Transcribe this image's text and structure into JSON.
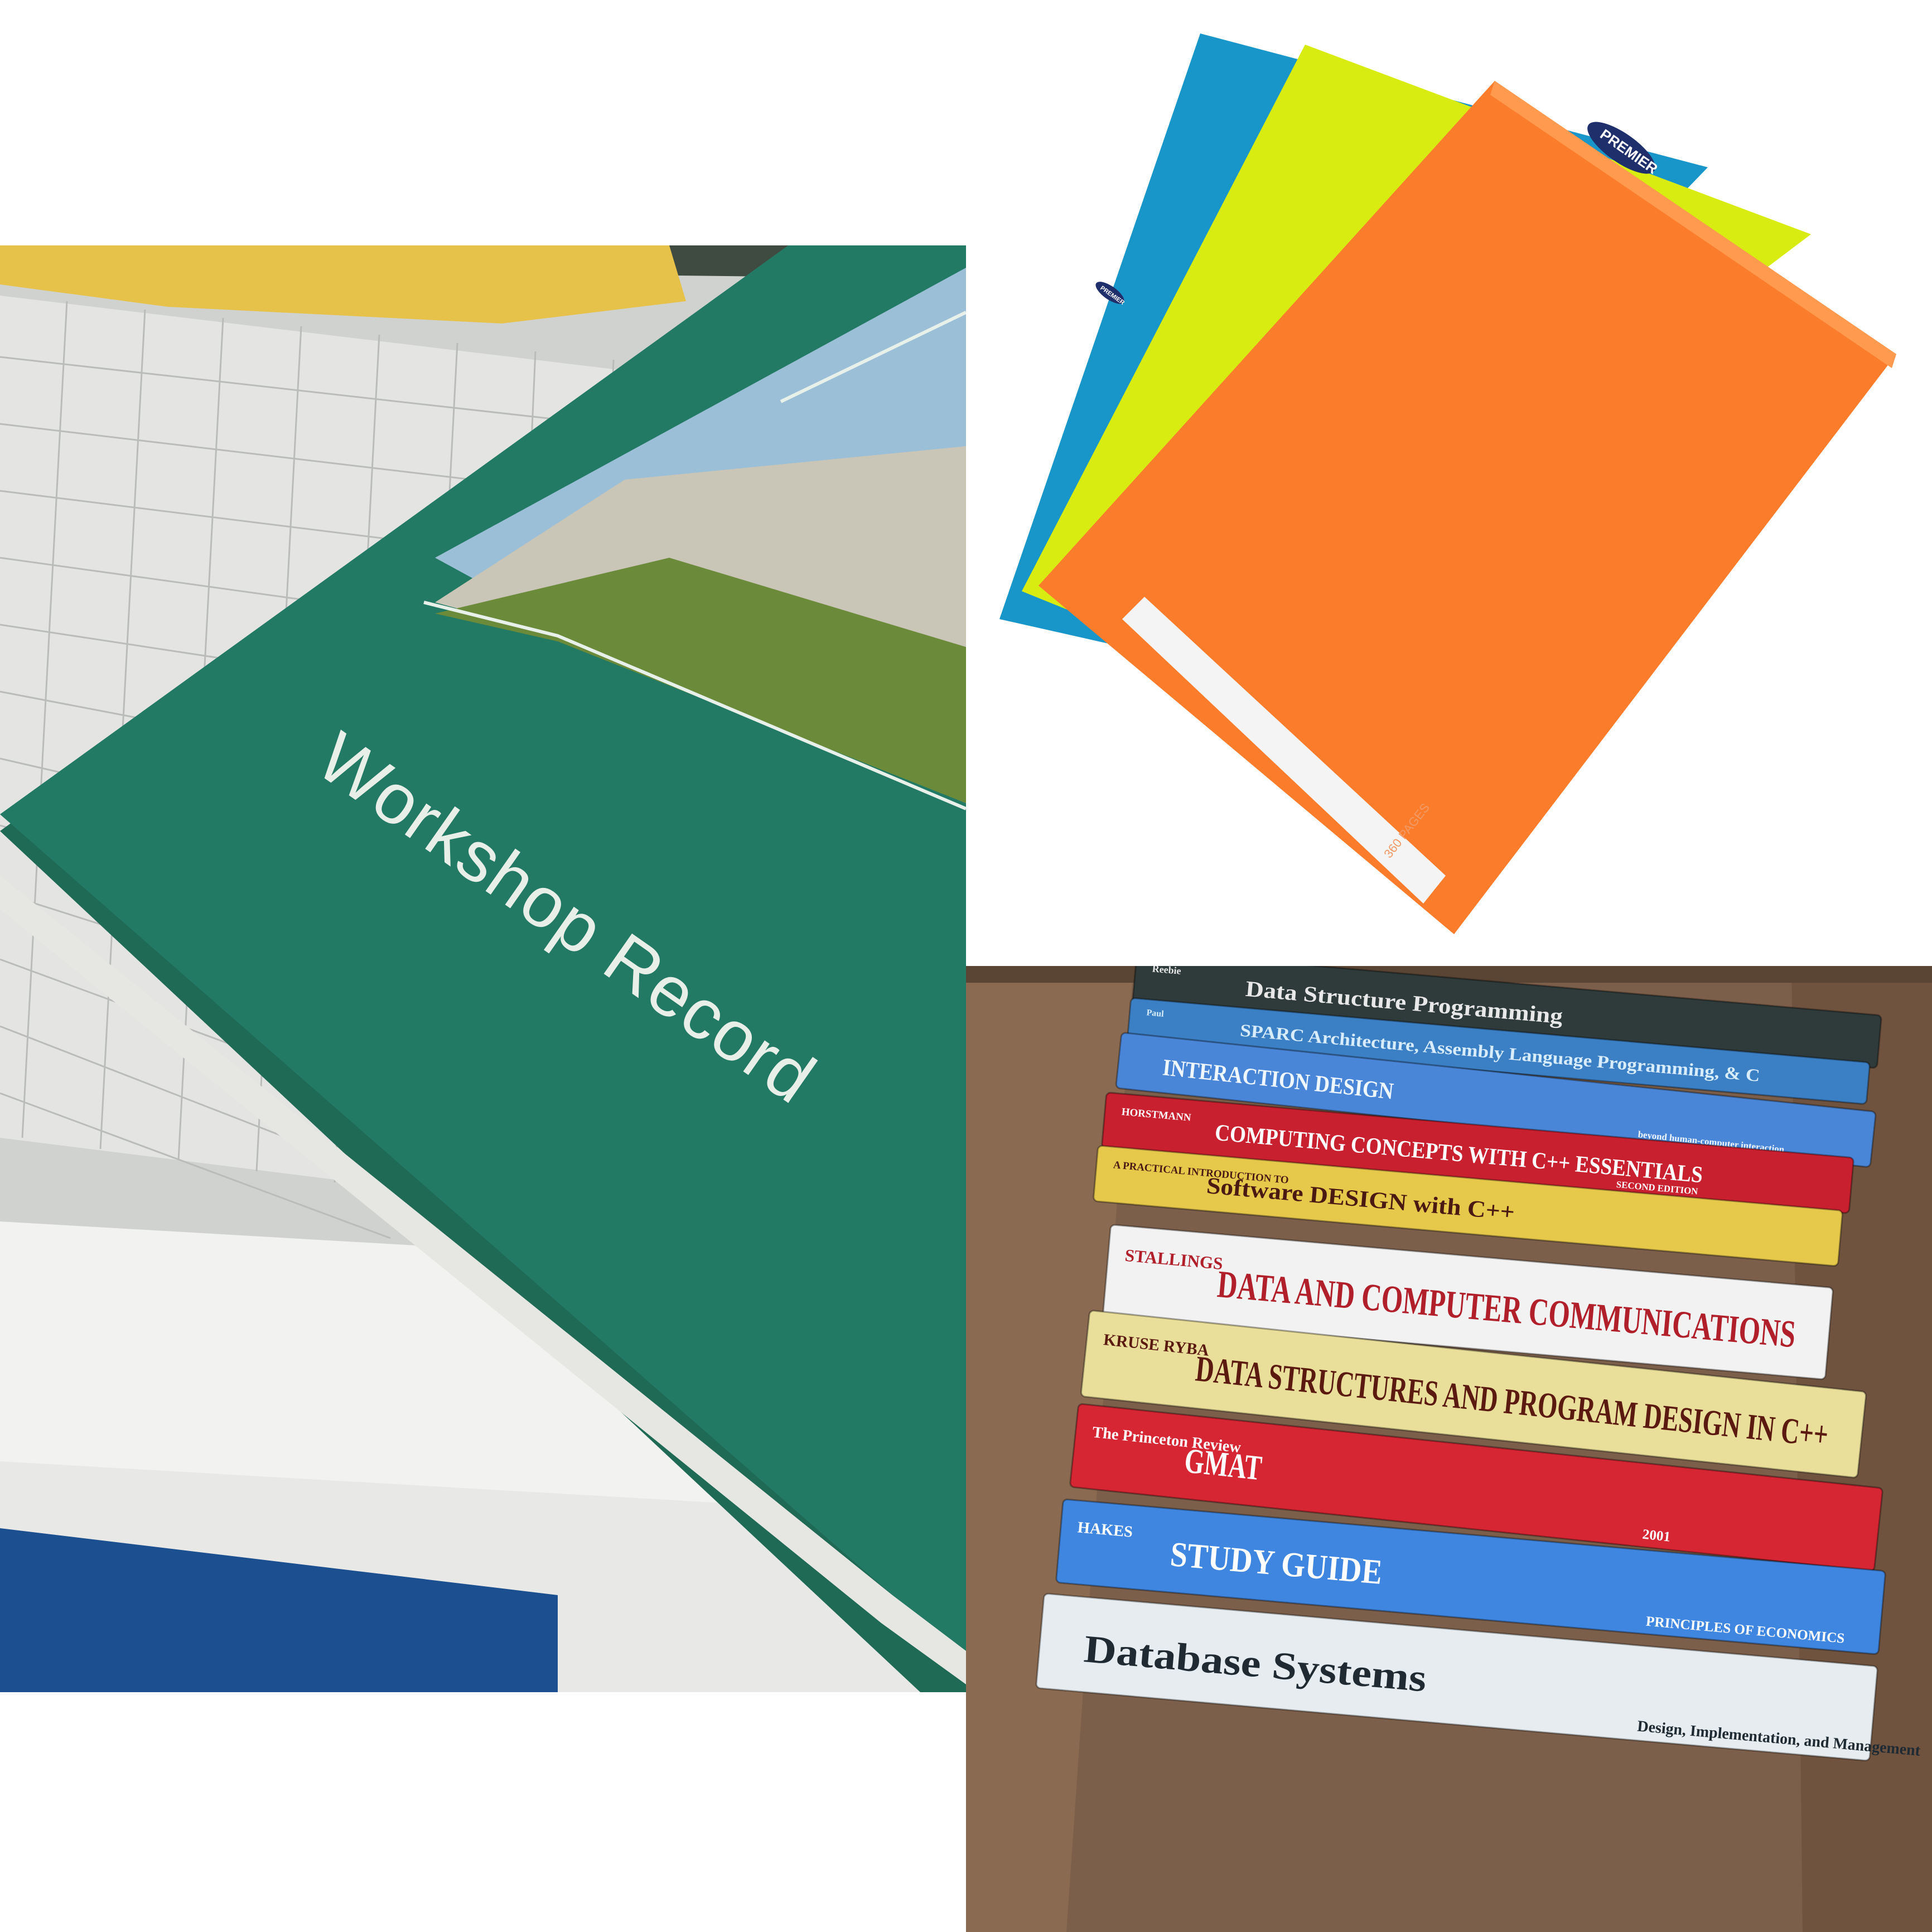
{
  "panels": {
    "workshop_record": {
      "cover_title": "Workshop Record"
    },
    "notebooks": {
      "brand": "PREMIER",
      "spine_brand": "PREMIER",
      "page_label": "360 PAGES"
    },
    "textbooks": {
      "spines": [
        {
          "id": "data-structure-programming",
          "author": "Reebie",
          "title": "Data Structure Programming",
          "subtitle": "",
          "color": "#2f3a3a",
          "text_color": "#e8e8e8"
        },
        {
          "id": "sparc",
          "author": "Paul",
          "title": "SPARC Architecture, Assembly Language Programming, & C",
          "subtitle": "",
          "color": "#3b7fc4",
          "text_color": "#d8ecff"
        },
        {
          "id": "interaction-design",
          "author": "",
          "title": "INTERACTION DESIGN",
          "subtitle": "beyond human-computer interaction",
          "color": "#4a86d8",
          "text_color": "#eef6ff"
        },
        {
          "id": "computing-concepts",
          "author": "HORSTMANN",
          "title": "COMPUTING CONCEPTS WITH C++ ESSENTIALS",
          "subtitle": "SECOND EDITION",
          "color": "#c8202e",
          "text_color": "#ffffff"
        },
        {
          "id": "software-design",
          "author": "A PRACTICAL INTRODUCTION TO",
          "title": "Software DESIGN with C++",
          "subtitle": "",
          "color": "#e6c84a",
          "text_color": "#4a1a12"
        },
        {
          "id": "data-computer-comm",
          "author": "STALLINGS",
          "title": "DATA AND COMPUTER COMMUNICATIONS",
          "subtitle": "",
          "color": "#f2f2f2",
          "text_color": "#b01f2a"
        },
        {
          "id": "data-structures-program",
          "author": "KRUSE RYBA",
          "title": "DATA STRUCTURES AND PROGRAM DESIGN IN C++",
          "subtitle": "",
          "color": "#eadf9a",
          "text_color": "#5a1a10"
        },
        {
          "id": "gmat",
          "author": "The Princeton Review",
          "title": "GMAT",
          "subtitle": "2001",
          "color": "#d62633",
          "text_color": "#ffffff"
        },
        {
          "id": "economics",
          "author": "HAKES",
          "title": "STUDY GUIDE",
          "subtitle": "PRINCIPLES OF ECONOMICS",
          "color": "#3f86e0",
          "text_color": "#ffffff"
        },
        {
          "id": "database-systems",
          "author": "",
          "title": "Database Systems",
          "subtitle": "Design, Implementation, and Management",
          "color": "#e6ecef",
          "text_color": "#1f2a33"
        }
      ]
    }
  },
  "colors": {
    "green_cover": "#237a64",
    "orange_notebook": "#fb7d2c",
    "yellow_notebook": "#d8ec12",
    "blue_notebook": "#1896c9",
    "box_cardboard": "#7b5f4a"
  }
}
